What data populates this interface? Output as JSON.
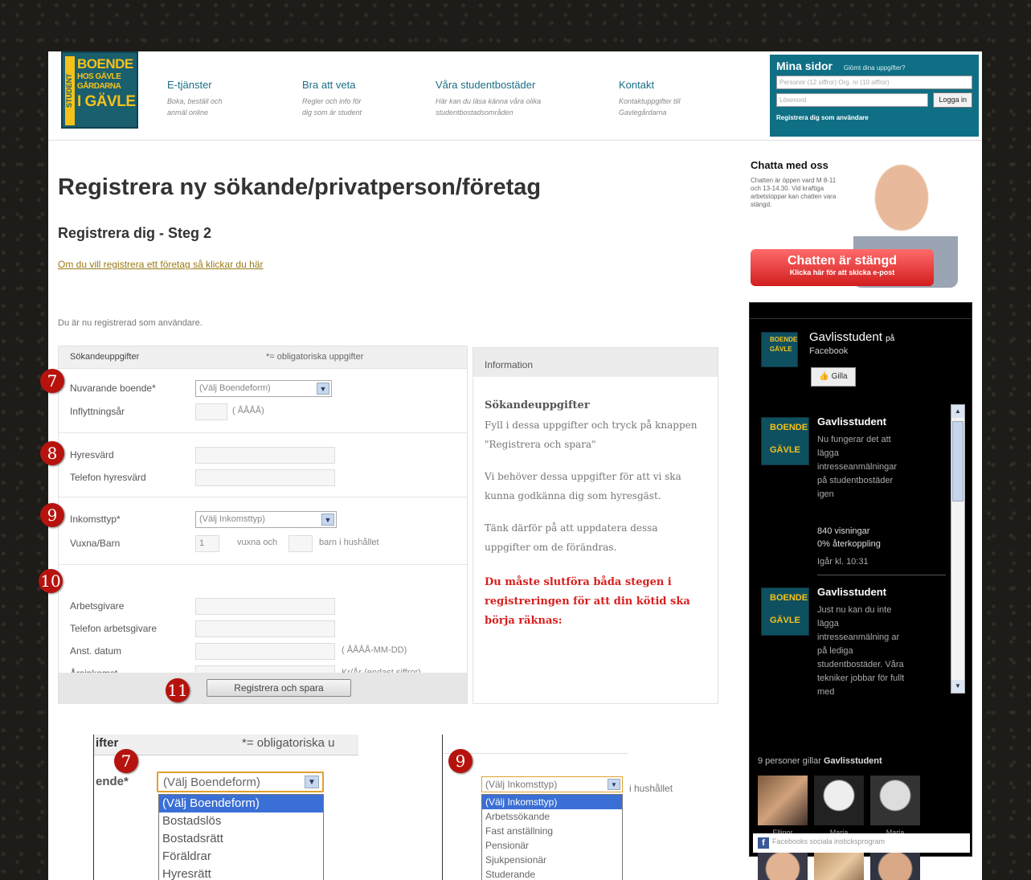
{
  "header": {
    "logo": {
      "vertical": "STUDENT",
      "line1": "BOENDE",
      "line2": "HOS GÄVLE",
      "line3": "GÅRDARNA",
      "line4": "I GÄVLE"
    },
    "nav": [
      {
        "title": "E-tjänster",
        "desc1": "Boka, beställ och",
        "desc2": "anmäl online"
      },
      {
        "title": "Bra att veta",
        "desc1": "Regler och info för",
        "desc2": "dig som är student"
      },
      {
        "title": "Våra studentbostäder",
        "desc1": "Här kan du läsa känna våra olika",
        "desc2": "studentbostadsområden"
      },
      {
        "title": "Kontakt",
        "desc1": "Kontaktuppgifter till",
        "desc2": "Gavlegårdarna"
      }
    ],
    "login": {
      "title": "Mina sidor",
      "forgot": "Glömt dina uppgifter?",
      "user_placeholder": "Personnr (12 siffror) Org. nr (10 siffror)",
      "pass_placeholder": "Lösenord",
      "login_button": "Logga in",
      "register": "Registrera dig som användare"
    }
  },
  "main": {
    "title": "Registrera ny sökande/privatperson/företag",
    "subtitle": "Registrera dig - Steg 2",
    "company_link": "Om du vill registrera ett företag så klickar du här",
    "registered_note": "Du är nu registrerad som användare.",
    "form": {
      "header": "Sökandeuppgifter",
      "required_note": "*= obligatoriska uppgifter",
      "fields": {
        "nuvarande_label": "Nuvarande boende*",
        "nuvarande_value": "(Välj Boendeform)",
        "inflytt_label": "Inflyttningsår",
        "inflytt_hint": "( ÅÅÅÅ)",
        "hyresvard_label": "Hyresvärd",
        "tel_hyresvard_label": "Telefon hyresvärd",
        "inkomsttyp_label": "Inkomsttyp*",
        "inkomsttyp_value": "(Välj Inkomsttyp)",
        "vuxna_label": "Vuxna/Barn",
        "vuxna_value": "1",
        "vuxna_och": "vuxna och",
        "barn_hint": "barn i hushållet",
        "arbetsgivare_label": "Arbetsgivare",
        "tel_arbetsgivare_label": "Telefon arbetsgivare",
        "anst_label": "Anst. datum",
        "anst_hint": "( ÅÅÅÅ-MM-DD)",
        "arsinkomst_label": "Årsinkomst",
        "arsinkomst_hint": "Kr/År (endast siffror)"
      },
      "save_button": "Registrera och spara"
    },
    "info": {
      "header": "Information",
      "title": "Sökandeuppgifter",
      "p1": "Fyll i dessa uppgifter och tryck på knappen \"Registrera och spara\"",
      "p2": "Vi behöver dessa uppgifter för att vi ska kunna godkänna dig som hyresgäst.",
      "p3": "Tänk därför på att uppdatera dessa uppgifter om de förändras.",
      "warning": "Du måste slutföra båda stegen i registreringen för att din kötid ska börja räknas:"
    }
  },
  "badges": [
    "7",
    "8",
    "9",
    "10",
    "11"
  ],
  "chat": {
    "title": "Chatta med oss",
    "text": "Chatten är öppen vard M 8-11 och 13-14.30. Vid kraftiga arbetstoppar kan chatten vara stängd.",
    "button_main": "Chatten är stängd",
    "button_sub": "Klicka här för att skicka e-post"
  },
  "facebook": {
    "page_name": "Gavlisstudent",
    "on": "på",
    "network": "Facebook",
    "like": "Gilla",
    "posts": [
      {
        "name": "Gavlisstudent",
        "text": "Nu fungerar det att lägga intresseanmälningar på studentbostäder igen",
        "views": "840 visningar",
        "feedback": "0% återkoppling",
        "time": "Igår kl. 10:31"
      },
      {
        "name": "Gavlisstudent",
        "text": "Just nu kan du inte lägga intresseanmälning ar på lediga studentbostäder. Våra tekniker jobbar för fullt med"
      }
    ],
    "likers": "9 personer gillar",
    "likers_page": "Gavlisstudent",
    "faces": [
      "Ellinor",
      "Maria",
      "Maria",
      "",
      "",
      ""
    ],
    "footer": "Facebooks sociala insticksprogram"
  },
  "inset_boende": {
    "header_fragment": "ifter",
    "req_fragment": "*= obligatoriska u",
    "label_fragment": "ende*",
    "selected": "(Välj Boendeform)",
    "options": [
      "(Välj Boendeform)",
      "Bostadslös",
      "Bostadsrätt",
      "Föräldrar",
      "Hyresrätt"
    ]
  },
  "inset_inkomst": {
    "selected": "(Välj Inkomsttyp)",
    "hint_fragment": "i hushållet",
    "options": [
      "(Välj Inkomsttyp)",
      "Arbetssökande",
      "Fast anställning",
      "Pensionär",
      "Sjukpensionär",
      "Studerande"
    ]
  },
  "colors": {
    "teal": "#0f6f84",
    "logo_yellow": "#f5c21b",
    "badge_red": "#b6130e",
    "warning_red": "#d81f1f"
  }
}
